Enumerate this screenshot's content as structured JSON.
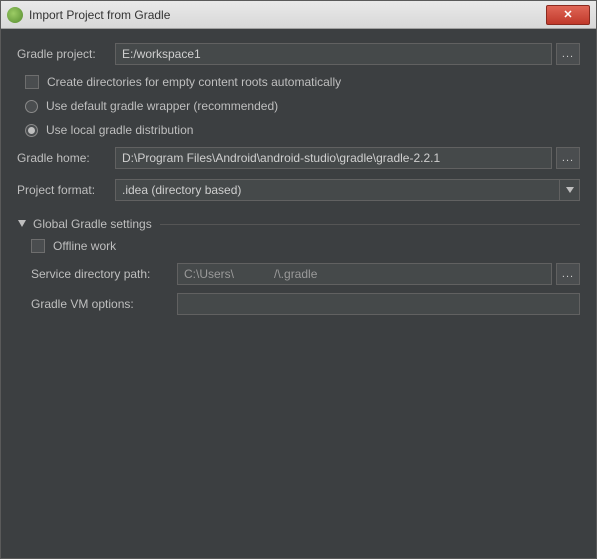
{
  "window": {
    "title": "Import Project from Gradle"
  },
  "fields": {
    "gradle_project_label": "Gradle project:",
    "gradle_project_value": "E:/workspace1",
    "create_dirs_label": "Create directories for empty content roots automatically",
    "use_default_wrapper_label": "Use default gradle wrapper (recommended)",
    "use_local_dist_label": "Use local gradle distribution",
    "gradle_home_label": "Gradle home:",
    "gradle_home_value": "D:\\Program Files\\Android\\android-studio\\gradle\\gradle-2.2.1",
    "project_format_label": "Project format:",
    "project_format_value": ".idea (directory based)"
  },
  "section": {
    "global_settings_label": "Global Gradle settings",
    "offline_work_label": "Offline work",
    "service_dir_label": "Service directory path:",
    "service_dir_value": "C:\\Users\\            /\\.gradle",
    "vm_options_label": "Gradle VM options:",
    "vm_options_value": ""
  },
  "buttons": {
    "ellipsis": "..."
  }
}
